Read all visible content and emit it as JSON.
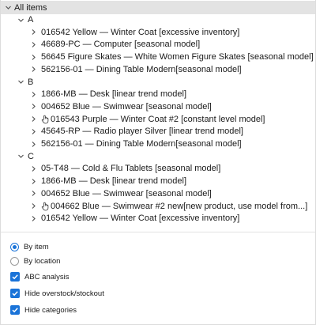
{
  "tree": {
    "root_label": "All items",
    "groups": [
      {
        "label": "A",
        "items": [
          {
            "label": "016542 Yellow — Winter Coat [excessive inventory]",
            "hand": false
          },
          {
            "label": "46689-PC — Computer [seasonal model]",
            "hand": false
          },
          {
            "label": "56645 Figure Skates — White Women Figure Skates [seasonal model]",
            "hand": false
          },
          {
            "label": "562156-01 — Dining Table Modern[seasonal model]",
            "hand": false
          }
        ]
      },
      {
        "label": "B",
        "items": [
          {
            "label": "1866-MB — Desk [linear trend model]",
            "hand": false
          },
          {
            "label": "004652 Blue — Swimwear [seasonal model]",
            "hand": false
          },
          {
            "label": "016543 Purple — Winter Coat #2 [constant level model]",
            "hand": true
          },
          {
            "label": "45645-RP — Radio player Silver [linear trend model]",
            "hand": false
          },
          {
            "label": "562156-01 — Dining Table Modern[seasonal model]",
            "hand": false
          }
        ]
      },
      {
        "label": "C",
        "items": [
          {
            "label": "05-T48 — Cold & Flu Tablets [seasonal model]",
            "hand": false
          },
          {
            "label": "1866-MB — Desk [linear trend model]",
            "hand": false
          },
          {
            "label": "004652 Blue — Swimwear [seasonal model]",
            "hand": false
          },
          {
            "label": "004662 Blue — Swimwear #2 new[new product, use model from...]",
            "hand": true
          },
          {
            "label": "016542 Yellow — Winter Coat [excessive inventory]",
            "hand": false
          }
        ]
      }
    ]
  },
  "options": {
    "radio_by_item": {
      "label": "By item",
      "selected": true
    },
    "radio_by_location": {
      "label": "By location",
      "selected": false
    },
    "check_abc": {
      "label": "ABC analysis",
      "checked": true
    },
    "check_hide_overstock": {
      "label": "Hide overstock/stockout",
      "checked": true
    },
    "check_hide_categories": {
      "label": "Hide categories",
      "checked": true
    }
  },
  "colors": {
    "accent": "#1a73d8",
    "root_row_bg": "#e3e3e3",
    "chevron": "#555555"
  }
}
